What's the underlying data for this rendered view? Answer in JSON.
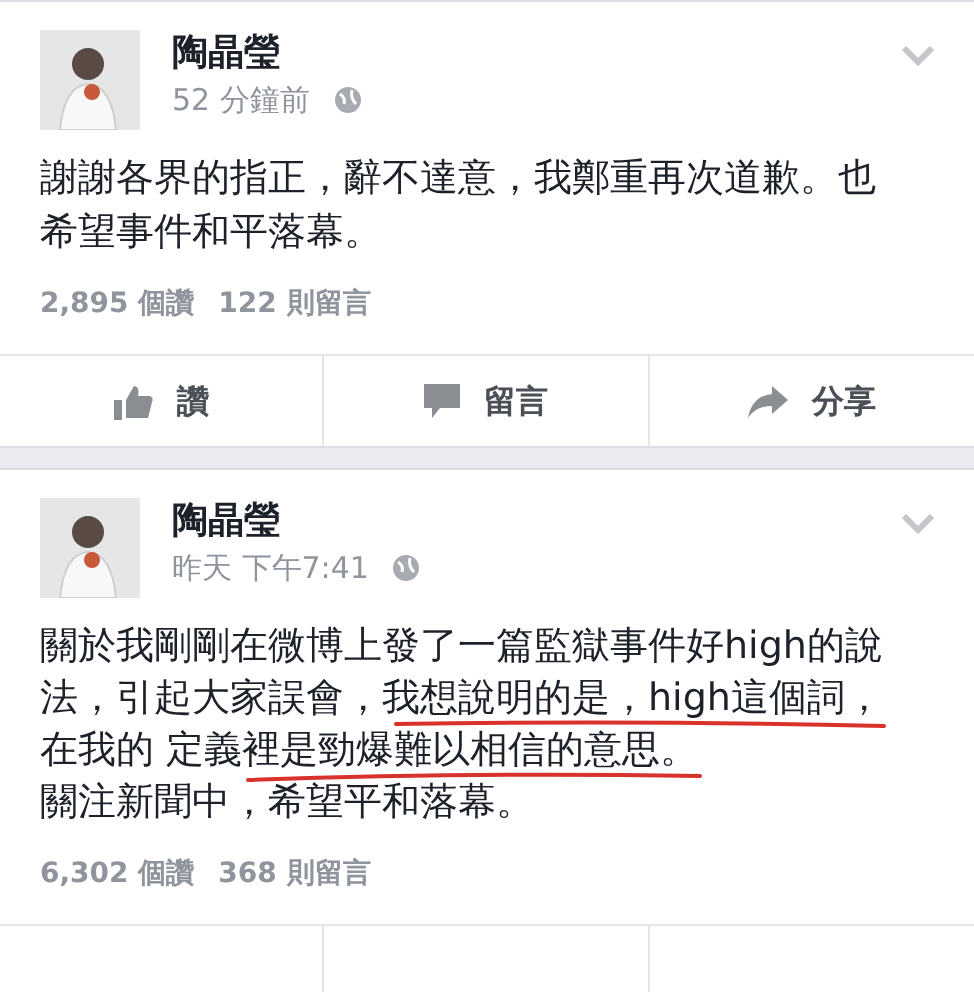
{
  "posts": [
    {
      "author": "陶晶瑩",
      "time": "52 分鐘前",
      "text_lines": [
        "謝謝各界的指正，辭不達意，我鄭重再次道歉。也",
        "希望事件和平落幕。"
      ],
      "likes": "2,895 個讚",
      "comments": "122 則留言",
      "actions": [
        {
          "kind": "like",
          "label": "讚"
        },
        {
          "kind": "comment",
          "label": "留言"
        },
        {
          "kind": "share",
          "label": "分享"
        }
      ],
      "underlined": false
    },
    {
      "author": "陶晶瑩",
      "time": "昨天 下午7:41",
      "text_lines": [
        "關於我剛剛在微博上發了一篇監獄事件好high的說",
        "法，引起大家誤會，我想說明的是，high這個詞，",
        "在我的 定義裡是勁爆難以相信的意思。",
        "關注新聞中，希望平和落幕。"
      ],
      "likes": "6,302 個讚",
      "comments": "368 則留言",
      "underlined": true
    }
  ]
}
